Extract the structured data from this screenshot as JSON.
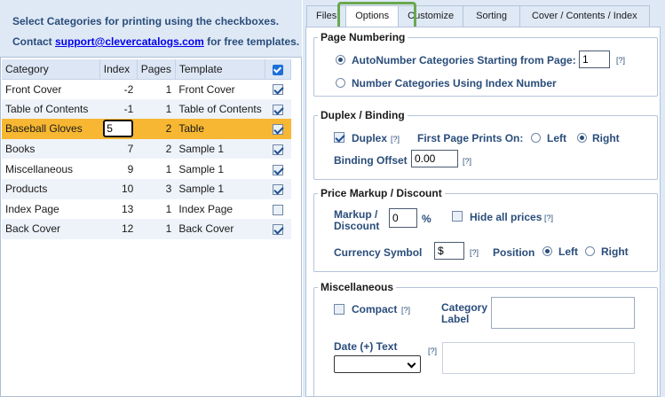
{
  "left": {
    "header_line1": "Select Categories for printing using the checkboxes.",
    "header_line2_prefix": "Contact ",
    "header_link": "support@clevercatalogs.com",
    "header_line2_suffix": " for free templates.",
    "columns": {
      "category": "Category",
      "index": "Index",
      "pages": "Pages",
      "template": "Template"
    },
    "rows": [
      {
        "category": "Front Cover",
        "index": "-2",
        "pages": "1",
        "template": "Front Cover",
        "checked": true
      },
      {
        "category": "Table of Contents",
        "index": "-1",
        "pages": "1",
        "template": "Table of Contents",
        "checked": true
      },
      {
        "category": "Baseball Gloves",
        "index": "5",
        "pages": "2",
        "template": "Table",
        "checked": true,
        "selected": true,
        "editing": true
      },
      {
        "category": "Books",
        "index": "7",
        "pages": "2",
        "template": "Sample 1",
        "checked": true
      },
      {
        "category": "Miscellaneous",
        "index": "9",
        "pages": "1",
        "template": "Sample 1",
        "checked": true
      },
      {
        "category": "Products",
        "index": "10",
        "pages": "3",
        "template": "Sample 1",
        "checked": true
      },
      {
        "category": "Index Page",
        "index": "13",
        "pages": "1",
        "template": "Index Page",
        "checked": false
      },
      {
        "category": "Back Cover",
        "index": "12",
        "pages": "1",
        "template": "Back Cover",
        "checked": true
      }
    ]
  },
  "tabs": [
    {
      "label": "Files",
      "active": false
    },
    {
      "label": "Options",
      "active": true
    },
    {
      "label": "Customize",
      "active": false
    },
    {
      "label": "Sorting",
      "active": false
    },
    {
      "label": "Cover / Contents / Index",
      "active": false
    }
  ],
  "page_numbering": {
    "legend": "Page Numbering",
    "auto_label": "AutoNumber Categories Starting from Page:",
    "auto_value": "1",
    "auto_selected": true,
    "index_label": "Number Categories Using Index Number",
    "help": "[?]"
  },
  "duplex": {
    "legend": "Duplex / Binding",
    "duplex_label": "Duplex",
    "duplex_checked": true,
    "first_page_label": "First Page Prints On:",
    "left_label": "Left",
    "right_label": "Right",
    "right_selected": true,
    "binding_label": "Binding Offset",
    "binding_value": "0.00",
    "help": "[?]"
  },
  "price": {
    "legend": "Price Markup / Discount",
    "markup_label_1": "Markup /",
    "markup_label_2": "Discount",
    "markup_value": "0",
    "percent": "%",
    "hide_label": "Hide all prices",
    "currency_label": "Currency Symbol",
    "currency_value": "$",
    "position_label": "Position",
    "left_label": "Left",
    "right_label": "Right",
    "left_selected": true,
    "help": "[?]"
  },
  "misc": {
    "legend": "Miscellaneous",
    "compact_label": "Compact",
    "category_label_1": "Category",
    "category_label_2": "Label",
    "date_label": "Date (+) Text",
    "help": "[?]"
  },
  "colors": {
    "panel_bg": "#dfe9f6",
    "selected_row": "#f7b733",
    "tab_highlight": "#6aa84f",
    "text_blue": "#2a4d7a"
  }
}
